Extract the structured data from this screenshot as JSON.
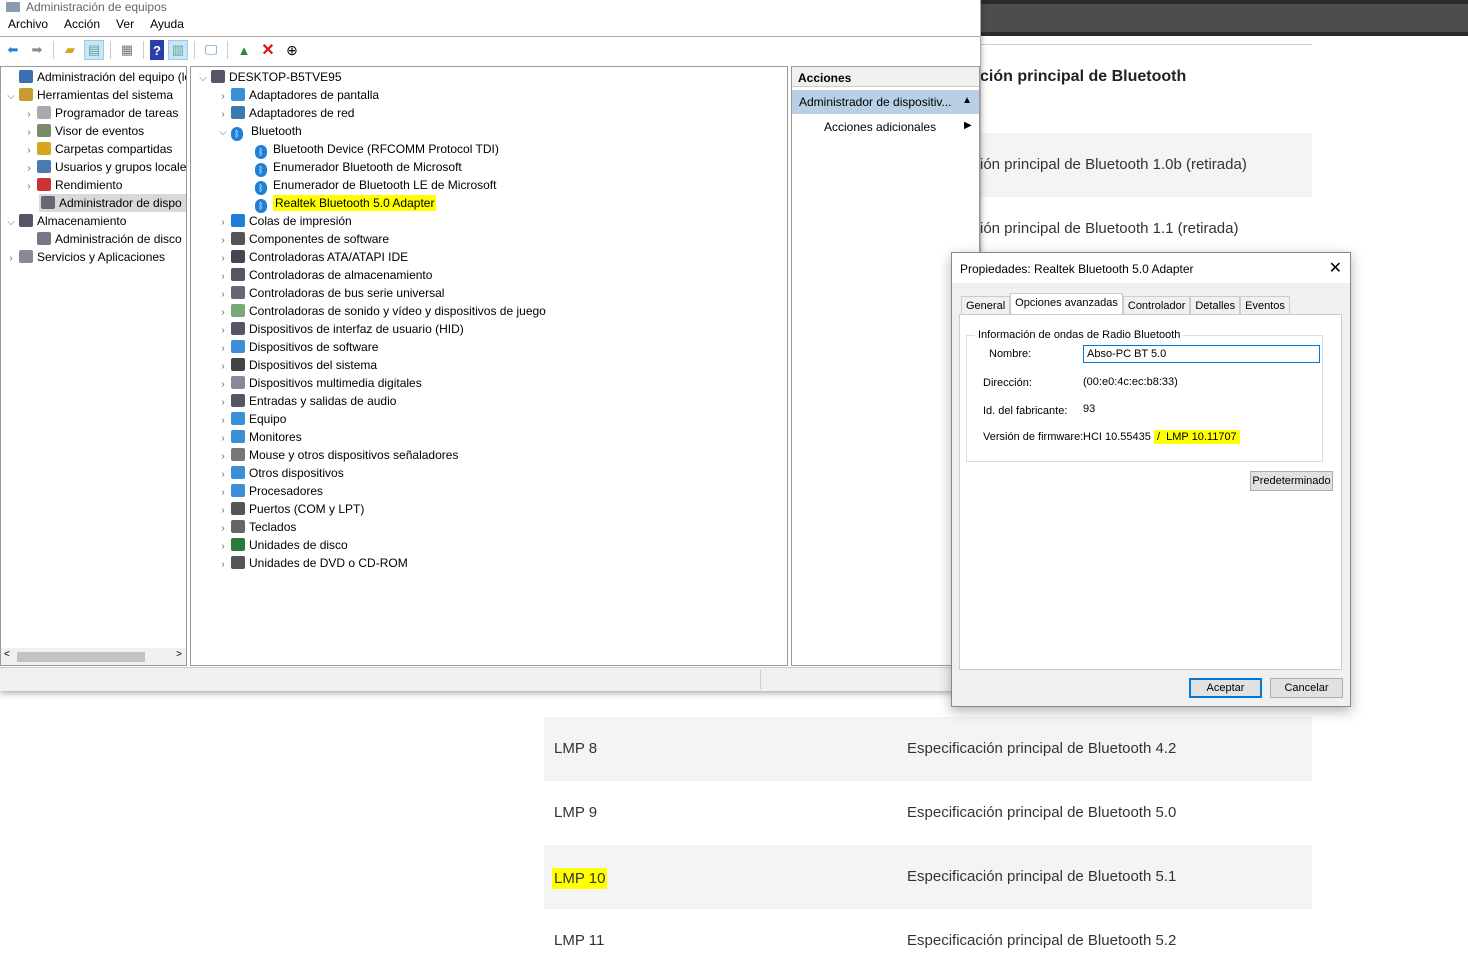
{
  "window_title": "Administración de equipos",
  "menu": [
    "Archivo",
    "Acción",
    "Ver",
    "Ayuda"
  ],
  "toolbar_icons": [
    "back-arrow-icon",
    "forward-arrow-icon",
    "up-folder-icon",
    "show-hide-tree-icon",
    "properties-icon",
    "help-icon",
    "show-action-pane-icon",
    "scan-hardware-icon",
    "update-driver-icon",
    "uninstall-icon",
    "disable-device-icon"
  ],
  "left_tree": [
    {
      "label": "Administración del equipo (loc",
      "level": 0,
      "arrow": ""
    },
    {
      "label": "Herramientas del sistema",
      "level": 0,
      "arrow": "v"
    },
    {
      "label": "Programador de tareas",
      "level": 1,
      "arrow": ">"
    },
    {
      "label": "Visor de eventos",
      "level": 1,
      "arrow": ">"
    },
    {
      "label": "Carpetas compartidas",
      "level": 1,
      "arrow": ">"
    },
    {
      "label": "Usuarios y grupos locale",
      "level": 1,
      "arrow": ">"
    },
    {
      "label": "Rendimiento",
      "level": 1,
      "arrow": ">"
    },
    {
      "label": "Administrador de dispo",
      "level": 1,
      "arrow": "",
      "selected": true
    },
    {
      "label": "Almacenamiento",
      "level": 0,
      "arrow": "v"
    },
    {
      "label": "Administración de disco",
      "level": 1,
      "arrow": ""
    },
    {
      "label": "Servicios y Aplicaciones",
      "level": 0,
      "arrow": ">"
    }
  ],
  "device_tree": {
    "root": "DESKTOP-B5TVE95",
    "items": [
      {
        "label": "Adaptadores de pantalla",
        "arrow": ">"
      },
      {
        "label": "Adaptadores de red",
        "arrow": ">"
      },
      {
        "label": "Bluetooth",
        "arrow": "v",
        "bt": true
      },
      {
        "label": "Bluetooth Device (RFCOMM Protocol TDI)",
        "child": true
      },
      {
        "label": "Enumerador Bluetooth de Microsoft",
        "child": true
      },
      {
        "label": "Enumerador de Bluetooth LE de Microsoft",
        "child": true
      },
      {
        "label": "Realtek Bluetooth 5.0 Adapter",
        "child": true,
        "highlight": true
      },
      {
        "label": "Colas de impresión",
        "arrow": ">"
      },
      {
        "label": "Componentes de software",
        "arrow": ">"
      },
      {
        "label": "Controladoras ATA/ATAPI IDE",
        "arrow": ">"
      },
      {
        "label": "Controladoras de almacenamiento",
        "arrow": ">"
      },
      {
        "label": "Controladoras de bus serie universal",
        "arrow": ">"
      },
      {
        "label": "Controladoras de sonido y vídeo y dispositivos de juego",
        "arrow": ">"
      },
      {
        "label": "Dispositivos de interfaz de usuario (HID)",
        "arrow": ">"
      },
      {
        "label": "Dispositivos de software",
        "arrow": ">"
      },
      {
        "label": "Dispositivos del sistema",
        "arrow": ">"
      },
      {
        "label": "Dispositivos multimedia digitales",
        "arrow": ">"
      },
      {
        "label": "Entradas y salidas de audio",
        "arrow": ">"
      },
      {
        "label": "Equipo",
        "arrow": ">"
      },
      {
        "label": "Monitores",
        "arrow": ">"
      },
      {
        "label": "Mouse y otros dispositivos señaladores",
        "arrow": ">"
      },
      {
        "label": "Otros dispositivos",
        "arrow": ">"
      },
      {
        "label": "Procesadores",
        "arrow": ">"
      },
      {
        "label": "Puertos (COM y LPT)",
        "arrow": ">"
      },
      {
        "label": "Teclados",
        "arrow": ">"
      },
      {
        "label": "Unidades de disco",
        "arrow": ">"
      },
      {
        "label": "Unidades de DVD o CD-ROM",
        "arrow": ">"
      }
    ]
  },
  "actions": {
    "header": "Acciones",
    "selected": "Administrador de dispositiv...",
    "sub": "Acciones adicionales"
  },
  "dialog": {
    "title": "Propiedades: Realtek Bluetooth 5.0 Adapter",
    "tabs": [
      "General",
      "Opciones avanzadas",
      "Controlador",
      "Detalles",
      "Eventos"
    ],
    "group_label": "Información de ondas de Radio Bluetooth",
    "name_label": "Nombre:",
    "name_value": "Abso-PC BT 5.0 ",
    "address_label": "Dirección:",
    "address_value": "(00:e0:4c:ec:b8:33)",
    "manufacturer_label": "Id. del fabricante:",
    "manufacturer_value": "93",
    "firmware_label": "Versión de firmware:",
    "firmware_hci": "HCI 10.55435",
    "firmware_sep": "/",
    "firmware_lmp": "LMP 10.11707",
    "default_button": "Predeterminado",
    "ok_button": "Aceptar",
    "cancel_button": "Cancelar"
  },
  "web": {
    "heading": "ción principal de Bluetooth",
    "rows_top": [
      "ión principal de Bluetooth 1.0b (retirada)",
      "ión principal de Bluetooth 1.1 (retirada)"
    ],
    "rows_bottom": [
      {
        "lmp": "LMP 8",
        "spec": "Especificación principal de Bluetooth 4.2"
      },
      {
        "lmp": "LMP 9",
        "spec": "Especificación principal de Bluetooth 5.0"
      },
      {
        "lmp": "LMP 10",
        "spec": "Especificación principal de Bluetooth 5.1",
        "highlight": true
      },
      {
        "lmp": "LMP 11",
        "spec": "Especificación principal de Bluetooth 5.2"
      }
    ]
  }
}
